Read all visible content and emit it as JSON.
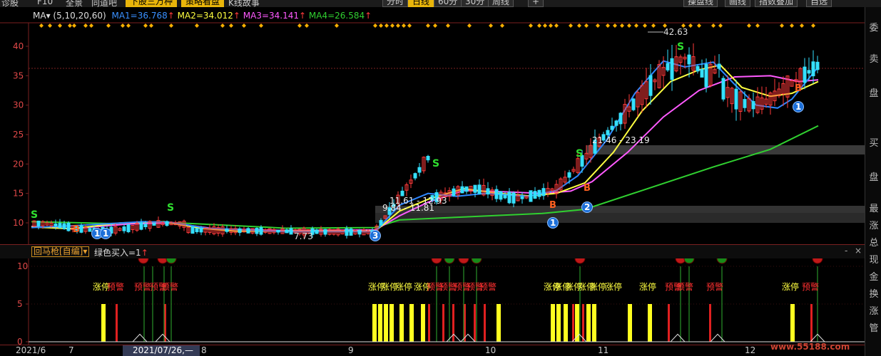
{
  "toolbar": {
    "items": [
      "诊股",
      "F10",
      "全景",
      "同道吧"
    ],
    "highlighted_1": "下股三万种",
    "highlighted_2": "策略看盘",
    "story": "K线故事",
    "periods": [
      "分时",
      "日线",
      "60分",
      "30分",
      "周线"
    ],
    "active_period": "日线",
    "add": "+",
    "right_items": [
      "操盘线",
      "画线",
      "指数叠加",
      "自选"
    ]
  },
  "legend": {
    "name": "MA",
    "params": "(5,10,20,60)",
    "ma1": "MA1=36.768",
    "ma2": "MA2=34.012",
    "ma3": "MA3=34.141",
    "ma4": "MA4=26.584",
    "up_arrow": "↑"
  },
  "colors": {
    "ma1": "#2e86ff",
    "ma2": "#ffff40",
    "ma3": "#ff5aff",
    "ma4": "#30d030",
    "up": "#ff3a3a",
    "down": "#35e0ff",
    "axis_text": "#e04848"
  },
  "y_ticks": [
    "40",
    "35",
    "30",
    "25",
    "20",
    "15",
    "10"
  ],
  "ind_y_ticks": [
    "10",
    "5",
    "0"
  ],
  "right_side": [
    "委",
    "卖",
    "盘",
    "买",
    "盘",
    "最",
    "涨",
    "总",
    "现",
    "金",
    "换",
    "涨",
    "管"
  ],
  "annotations": {
    "high": "42.63",
    "low": "7.73",
    "range1": "21.46 - 23.19",
    "range2": "11.61 - 12.93",
    "range3": "9.84 - 11.81",
    "s": "S",
    "b": "B",
    "one": "1",
    "two": "2",
    "three": "3",
    "eleven": "11"
  },
  "indicator": {
    "title": "回马枪[自编]",
    "dropdown": "▾",
    "condition": "绿色买入=1",
    "up_arrow": "↑",
    "labels": {
      "zt": "涨停",
      "yj": "预警"
    },
    "controls": [
      "-",
      "×"
    ]
  },
  "xaxis": {
    "start": "2021/6",
    "m7": "7",
    "cursor": "2021/07/26,—",
    "m8": "8",
    "m9": "9",
    "m10": "10",
    "m11": "11",
    "m12": "12"
  },
  "watermark": "www.55188.com"
}
